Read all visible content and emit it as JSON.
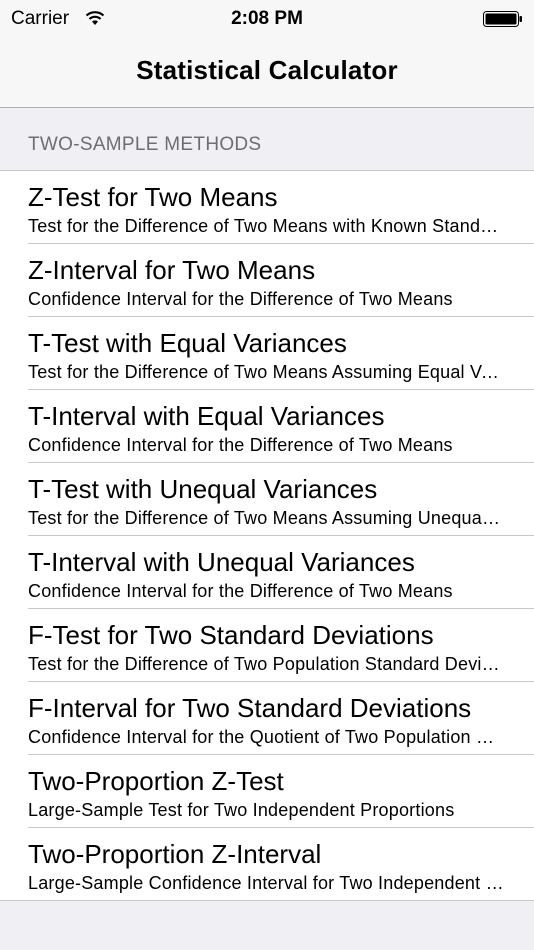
{
  "status": {
    "carrier": "Carrier",
    "time": "2:08 PM"
  },
  "nav": {
    "title": "Statistical Calculator"
  },
  "section": {
    "header": "TWO-SAMPLE METHODS"
  },
  "rows": [
    {
      "title": "Z-Test for Two Means",
      "subtitle": "Test for the Difference of Two Means with Known Standard Deviations"
    },
    {
      "title": "Z-Interval for Two Means",
      "subtitle": "Confidence Interval for the Difference of Two Means"
    },
    {
      "title": "T-Test with Equal Variances",
      "subtitle": "Test for the Difference of Two Means Assuming Equal Variances"
    },
    {
      "title": "T-Interval with Equal Variances",
      "subtitle": "Confidence Interval for the Difference of Two Means"
    },
    {
      "title": "T-Test with Unequal Variances",
      "subtitle": "Test for the Difference of Two Means Assuming Unequal Variances"
    },
    {
      "title": "T-Interval with Unequal Variances",
      "subtitle": "Confidence Interval for the Difference of Two Means"
    },
    {
      "title": "F-Test for Two Standard Deviations",
      "subtitle": "Test for the Difference of Two Population Standard Deviations"
    },
    {
      "title": "F-Interval for Two Standard Deviations",
      "subtitle": "Confidence Interval for the Quotient of Two Population Standard Deviations"
    },
    {
      "title": "Two-Proportion Z-Test",
      "subtitle": "Large-Sample Test for Two Independent Proportions"
    },
    {
      "title": "Two-Proportion Z-Interval",
      "subtitle": "Large-Sample Confidence Interval for Two Independent Proportions"
    }
  ]
}
